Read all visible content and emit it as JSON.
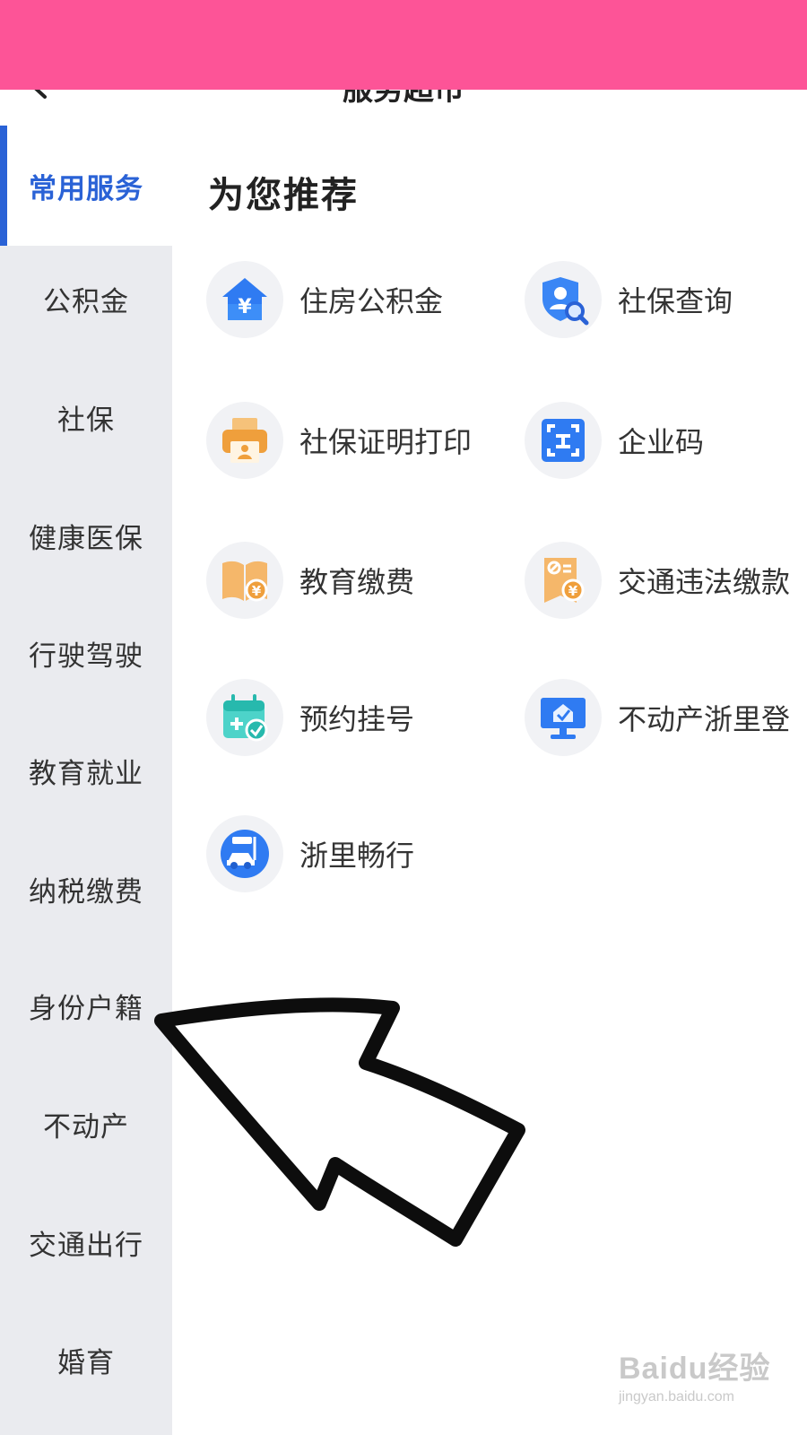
{
  "header": {
    "title": "服务超市",
    "back_icon": "chevron-left-icon"
  },
  "sidebar": {
    "items": [
      {
        "label": "常用服务",
        "active": true
      },
      {
        "label": "公积金"
      },
      {
        "label": "社保"
      },
      {
        "label": "健康医保"
      },
      {
        "label": "行驶驾驶"
      },
      {
        "label": "教育就业"
      },
      {
        "label": "纳税缴费"
      },
      {
        "label": "身份户籍"
      },
      {
        "label": "不动产"
      },
      {
        "label": "交通出行"
      },
      {
        "label": "婚育"
      }
    ]
  },
  "main": {
    "section_title": "为您推荐",
    "services": [
      {
        "label": "住房公积金",
        "icon": "house-yuan-icon"
      },
      {
        "label": "社保查询",
        "icon": "shield-person-search-icon"
      },
      {
        "label": "社保证明打印",
        "icon": "printer-icon"
      },
      {
        "label": "企业码",
        "icon": "scan-code-icon"
      },
      {
        "label": "教育缴费",
        "icon": "book-yuan-icon"
      },
      {
        "label": "交通违法缴款",
        "icon": "ticket-yuan-icon"
      },
      {
        "label": "预约挂号",
        "icon": "calendar-plus-icon"
      },
      {
        "label": "不动产浙里登",
        "icon": "monitor-house-icon"
      },
      {
        "label": "浙里畅行",
        "icon": "car-icon"
      }
    ]
  },
  "overlay": {
    "arrow_icon": "pointer-arrow-icon"
  },
  "watermark": {
    "logo": "Baidu经验",
    "url": "jingyan.baidu.com"
  },
  "colors": {
    "accent": "#2a62d6",
    "pink_bar": "#fd5497",
    "sidebar_bg": "#eaebef"
  }
}
